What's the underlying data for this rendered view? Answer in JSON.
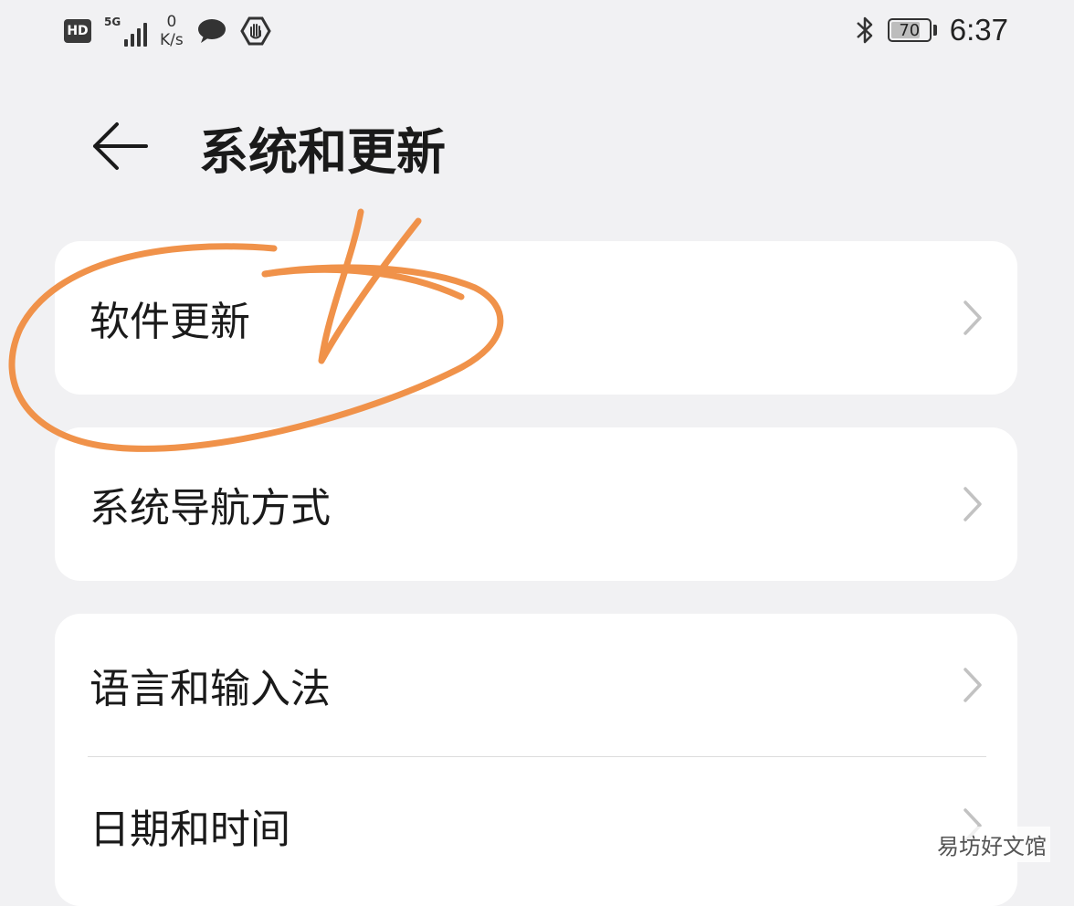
{
  "status_bar": {
    "hd": "HD",
    "network": "5G",
    "speed_value": "0",
    "speed_unit": "K/s",
    "icons_left": [
      "hd-icon",
      "signal-icon",
      "message-icon",
      "hand-shield-icon"
    ],
    "icons_right": [
      "bluetooth-icon",
      "battery-icon"
    ],
    "battery_level": "70",
    "time": "6:37"
  },
  "header": {
    "title": "系统和更新"
  },
  "menu": {
    "software_update": "软件更新",
    "system_navigation": "系统导航方式",
    "language_input": "语言和输入法",
    "date_time": "日期和时间"
  },
  "annotation": {
    "color": "#f0924a"
  },
  "watermark": "易坊好文馆",
  "colors": {
    "background": "#f1f1f3",
    "card": "#ffffff",
    "chevron": "#c2c2c2",
    "text": "#1a1a1a"
  }
}
